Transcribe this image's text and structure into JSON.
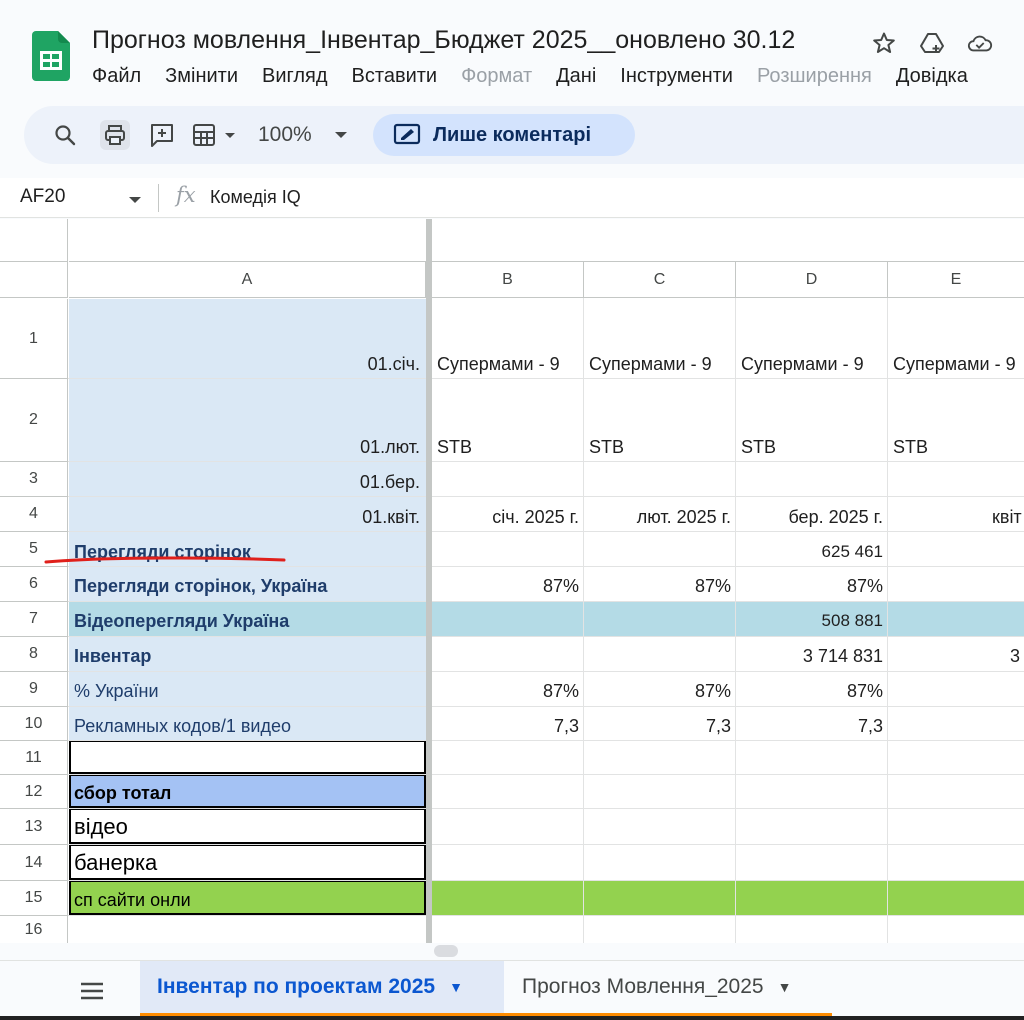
{
  "app": {
    "doc_title": "Прогноз мовлення_Інвентар_Бюджет 2025__оновлено 30.12",
    "menu": [
      {
        "label": "Файл",
        "disabled": false
      },
      {
        "label": "Змінити",
        "disabled": false
      },
      {
        "label": "Вигляд",
        "disabled": false
      },
      {
        "label": "Вставити",
        "disabled": false
      },
      {
        "label": "Формат",
        "disabled": true
      },
      {
        "label": "Дані",
        "disabled": false
      },
      {
        "label": "Інструменти",
        "disabled": false
      },
      {
        "label": "Розширення",
        "disabled": true
      },
      {
        "label": "Довідка",
        "disabled": false
      }
    ]
  },
  "toolbar": {
    "zoom": "100%",
    "mode_label": "Лише коментарі",
    "icons": [
      "search-icon",
      "print-icon",
      "add-comment-icon",
      "filter-views-icon",
      "comment-mode-icon"
    ]
  },
  "formula_bar": {
    "cell_ref": "AF20",
    "fx": "fx",
    "value": "Комедія IQ"
  },
  "grid": {
    "columns": [
      "A",
      "B",
      "C",
      "D",
      "E"
    ],
    "rows": [
      {
        "num": "1",
        "a": "01.січ.",
        "b": "Супермами - 9",
        "c": "Супермами - 9",
        "d": "Супермами - 9",
        "e": "Супермами - 9"
      },
      {
        "num": "2",
        "a": "01.лют.",
        "b": "STB",
        "c": "STB",
        "d": "STB",
        "e": "STB"
      },
      {
        "num": "3",
        "a": "01.бер.",
        "b": "",
        "c": "",
        "d": "",
        "e": ""
      },
      {
        "num": "4",
        "a": "01.квіт.",
        "b": "січ. 2025 г.",
        "c": "лют. 2025 г.",
        "d": "бер. 2025 г.",
        "e": "квіт"
      },
      {
        "num": "5",
        "a": "Перегляди сторінок",
        "b": "",
        "c": "",
        "d": "625 461",
        "e": ""
      },
      {
        "num": "6",
        "a": "Перегляди сторінок, Україна",
        "b": "87%",
        "c": "87%",
        "d": "87%",
        "e": ""
      },
      {
        "num": "7",
        "a": "Відеоперегляди Україна",
        "b": "",
        "c": "",
        "d": "508 881",
        "e": ""
      },
      {
        "num": "8",
        "a": "Інвентар",
        "b": "",
        "c": "",
        "d": "3 714 831",
        "e": "3"
      },
      {
        "num": "9",
        "a": "% України",
        "b": "87%",
        "c": "87%",
        "d": "87%",
        "e": ""
      },
      {
        "num": "10",
        "a": "Рекламных кодов/1 видео",
        "b": "7,3",
        "c": "7,3",
        "d": "7,3",
        "e": ""
      },
      {
        "num": "11",
        "a": "",
        "b": "",
        "c": "",
        "d": "",
        "e": ""
      },
      {
        "num": "12",
        "a": "сбор тотал",
        "b": "",
        "c": "",
        "d": "",
        "e": ""
      },
      {
        "num": "13",
        "a": "відео",
        "b": "",
        "c": "",
        "d": "",
        "e": ""
      },
      {
        "num": "14",
        "a": "банерка",
        "b": "",
        "c": "",
        "d": "",
        "e": ""
      },
      {
        "num": "15",
        "a": "сп сайти онли",
        "b": "",
        "c": "",
        "d": "",
        "e": ""
      },
      {
        "num": "16",
        "a": "",
        "b": "",
        "c": "",
        "d": "",
        "e": ""
      }
    ]
  },
  "sheets": [
    {
      "label": "Інвентар по проектам 2025",
      "active": true
    },
    {
      "label": "Прогноз Мовлення_2025",
      "active": false
    }
  ],
  "colors": {
    "col_a_fill": "#dae8f5",
    "row7_fill": "#b4dbe6",
    "row12_fill": "#a4c2f4",
    "row15_fill": "#93d24f",
    "annotation_red": "#e0201b",
    "label_text": "#1f3d6b"
  }
}
